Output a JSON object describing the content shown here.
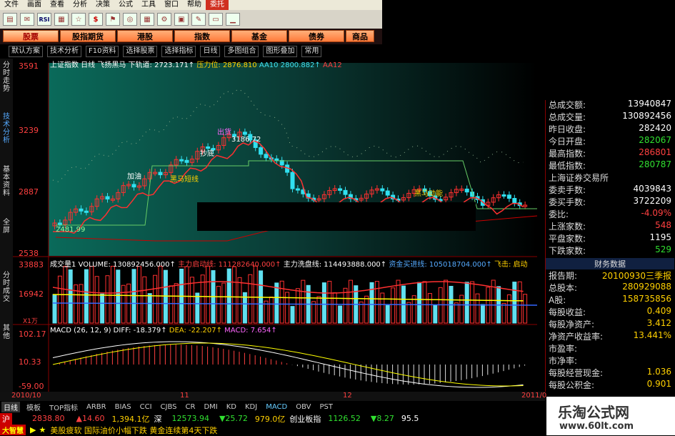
{
  "menu": [
    "文件",
    "画面",
    "查看",
    "分析",
    "决策",
    "公式",
    "工具",
    "窗口",
    "帮助",
    "委托"
  ],
  "toolbar_icons": [
    "chart-bar-icon",
    "mail-icon",
    "rsi-icon",
    "indicator-icon",
    "star-icon",
    "dollar-icon",
    "flag-icon",
    "binoculars-icon",
    "grid-icon",
    "gear-icon",
    "lock-icon",
    "brush-icon",
    "window-icon",
    "minimize-icon"
  ],
  "toolbar_rsi_label": "RSI",
  "toolbar_dollar_label": "$",
  "market_tabs": [
    "股票",
    "股指期货",
    "港股",
    "指数",
    "基金",
    "债券",
    "商品"
  ],
  "subbar": [
    "默认方案",
    "技术分析",
    "F10资料",
    "选择股票",
    "选择指标",
    "日线",
    "多图组合",
    "图形叠加",
    "常用"
  ],
  "left_tabs": [
    "分时走势",
    "技术分析",
    "基本资料",
    "全屏",
    "分时成交",
    "其他"
  ],
  "chart_header": {
    "title": "上证指数 日线 飞扬黑马",
    "down_track": "下轨道: 2723.171↑",
    "pressure": "压力位: 2876.810",
    "aa10": "AA10",
    "aa10_val": "2800.882↑",
    "aa12": "AA12"
  },
  "price_axis": [
    "3591",
    "3239",
    "2887",
    "2538"
  ],
  "price_annotations": {
    "high": "3186.72",
    "low": "2481.99",
    "label1": "黑马短线",
    "label2": "加油",
    "label3": "出货",
    "label4": "抄底",
    "label5": "黑马动能"
  },
  "volume_header": {
    "name": "成交量1",
    "volume": "VOLUME: 130892456.000↑",
    "main_start": "主力启动线: 111282640.000↑",
    "wash": "主力洗盘线: 114493888.000↑",
    "buy": "资金买进线: 105018704.000↑",
    "tip": "飞击: 启动"
  },
  "volume_axis": [
    "33883",
    "16942",
    "X1万"
  ],
  "macd_header": {
    "name": "MACD (26, 12, 9)",
    "diff": "DIFF: -18.379↑",
    "dea": "DEA: -22.207↑",
    "macd": "MACD: 7.654↑"
  },
  "macd_axis": [
    "102.17",
    "10.33",
    "-59.00"
  ],
  "date_axis": [
    "2010/10",
    "11",
    "12",
    "2011/0"
  ],
  "indicator_tabs": [
    "日线",
    "模板",
    "TOP指标",
    "ARBR",
    "BIAS",
    "CCI",
    "CJBS",
    "CR",
    "DMI",
    "KD",
    "KDJ",
    "MACD",
    "OBV",
    "PST"
  ],
  "right_panel": [
    {
      "k": "总成交额:",
      "v": "13940847",
      "c": "white"
    },
    {
      "k": "总成交量:",
      "v": "130892456",
      "c": "white"
    },
    {
      "k": "昨日收盘:",
      "v": "282420",
      "c": "white"
    },
    {
      "k": "今日开盘:",
      "v": "282067",
      "c": "green"
    },
    {
      "k": "最高指数:",
      "v": "286801",
      "c": "red"
    },
    {
      "k": "最低指数:",
      "v": "280787",
      "c": "green"
    },
    {
      "k": "上海证券交易所",
      "v": "",
      "c": "white"
    },
    {
      "k": "委卖手数:",
      "v": "4039843",
      "c": "white"
    },
    {
      "k": "委买手数:",
      "v": "3722209",
      "c": "white"
    },
    {
      "k": "委比:",
      "v": "-4.09%",
      "c": "red"
    },
    {
      "k": "上涨家数:",
      "v": "548",
      "c": "red"
    },
    {
      "k": "平盘家数:",
      "v": "1195",
      "c": "white"
    },
    {
      "k": "下跌家数:",
      "v": "529",
      "c": "green"
    }
  ],
  "finance_title": "财务数据",
  "finance": [
    {
      "k": "报告期:",
      "v": "20100930三季报",
      "c": "yellow"
    },
    {
      "k": "总股本:",
      "v": "280929088",
      "c": "yellow"
    },
    {
      "k": "A股:",
      "v": "158735856",
      "c": "yellow"
    },
    {
      "k": "每股收益:",
      "v": "0.409",
      "c": "yellow"
    },
    {
      "k": "每股净资产:",
      "v": "3.412",
      "c": "yellow"
    },
    {
      "k": "净资产收益率:",
      "v": "13.441%",
      "c": "yellow"
    },
    {
      "k": "市盈率:",
      "v": "",
      "c": "yellow"
    },
    {
      "k": "市净率:",
      "v": "",
      "c": "yellow"
    },
    {
      "k": "每股经营现金:",
      "v": "1.036",
      "c": "yellow"
    },
    {
      "k": "每股公积金:",
      "v": "0.901",
      "c": "yellow"
    }
  ],
  "index_bar": {
    "sh_label": "沪",
    "sh_price": "2838.80",
    "sh_change": "▲14.60",
    "sh_amount": "1,394.1亿",
    "sz_label": "深",
    "sz_price": "12573.94",
    "sz_change": "▼25.72",
    "sz_amount": "979.0亿",
    "cy_label": "创业板指",
    "cy_price": "1126.52",
    "cy_change": "▼8.27",
    "extra": "95.5"
  },
  "news": {
    "logo": "大智慧",
    "text": "美股疲软 国际油价小幅下跌 黄金连续第4天下跌"
  },
  "watermark": {
    "title": "乐淘公式网",
    "url": "www.60lt.com"
  },
  "colors": {
    "up": "#ff3030",
    "down": "#30e0f0",
    "accent": "#ffd000"
  }
}
